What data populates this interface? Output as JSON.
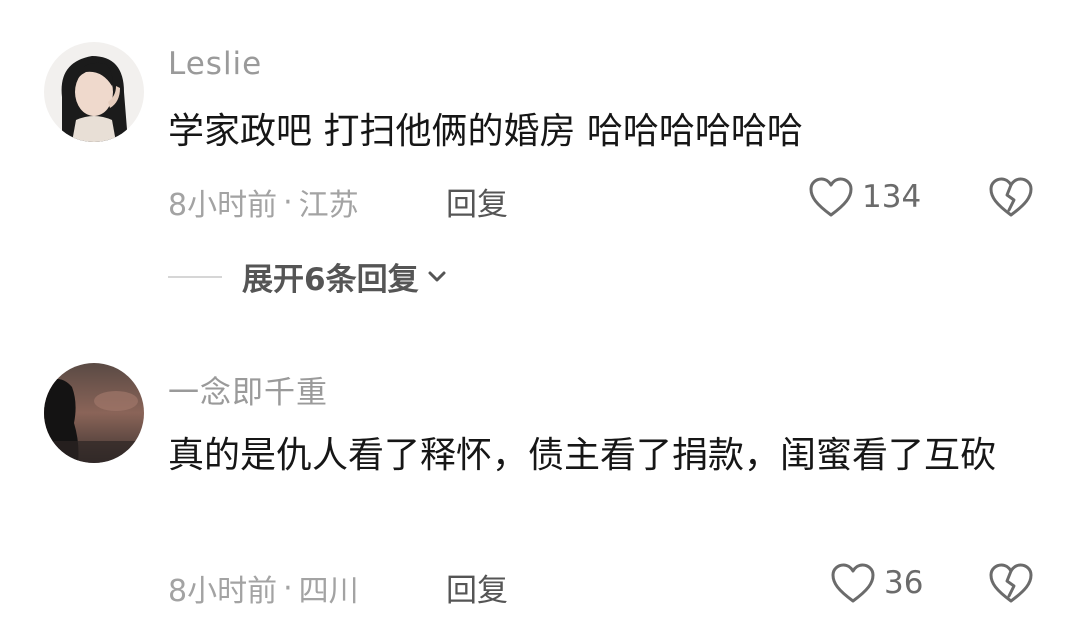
{
  "comments": [
    {
      "username": "Leslie",
      "content": "学家政吧 打扫他俩的婚房 哈哈哈哈哈哈",
      "time": "8小时前",
      "separator": "·",
      "location": "江苏",
      "reply_label": "回复",
      "likes": "134",
      "expand_label": "展开6条回复"
    },
    {
      "username": "一念即千重",
      "content": "真的是仇人看了释怀，债主看了捐款，闺蜜看了互砍",
      "time": "8小时前",
      "separator": "·",
      "location": "四川",
      "reply_label": "回复",
      "likes": "36"
    }
  ],
  "icons": {
    "like": "heart-outline-icon",
    "dislike": "broken-heart-icon",
    "expand": "chevron-down-icon"
  },
  "colors": {
    "text_primary": "#161616",
    "text_secondary": "#9a9a9a",
    "action_text": "#555555",
    "icon": "#6b6b6b"
  }
}
